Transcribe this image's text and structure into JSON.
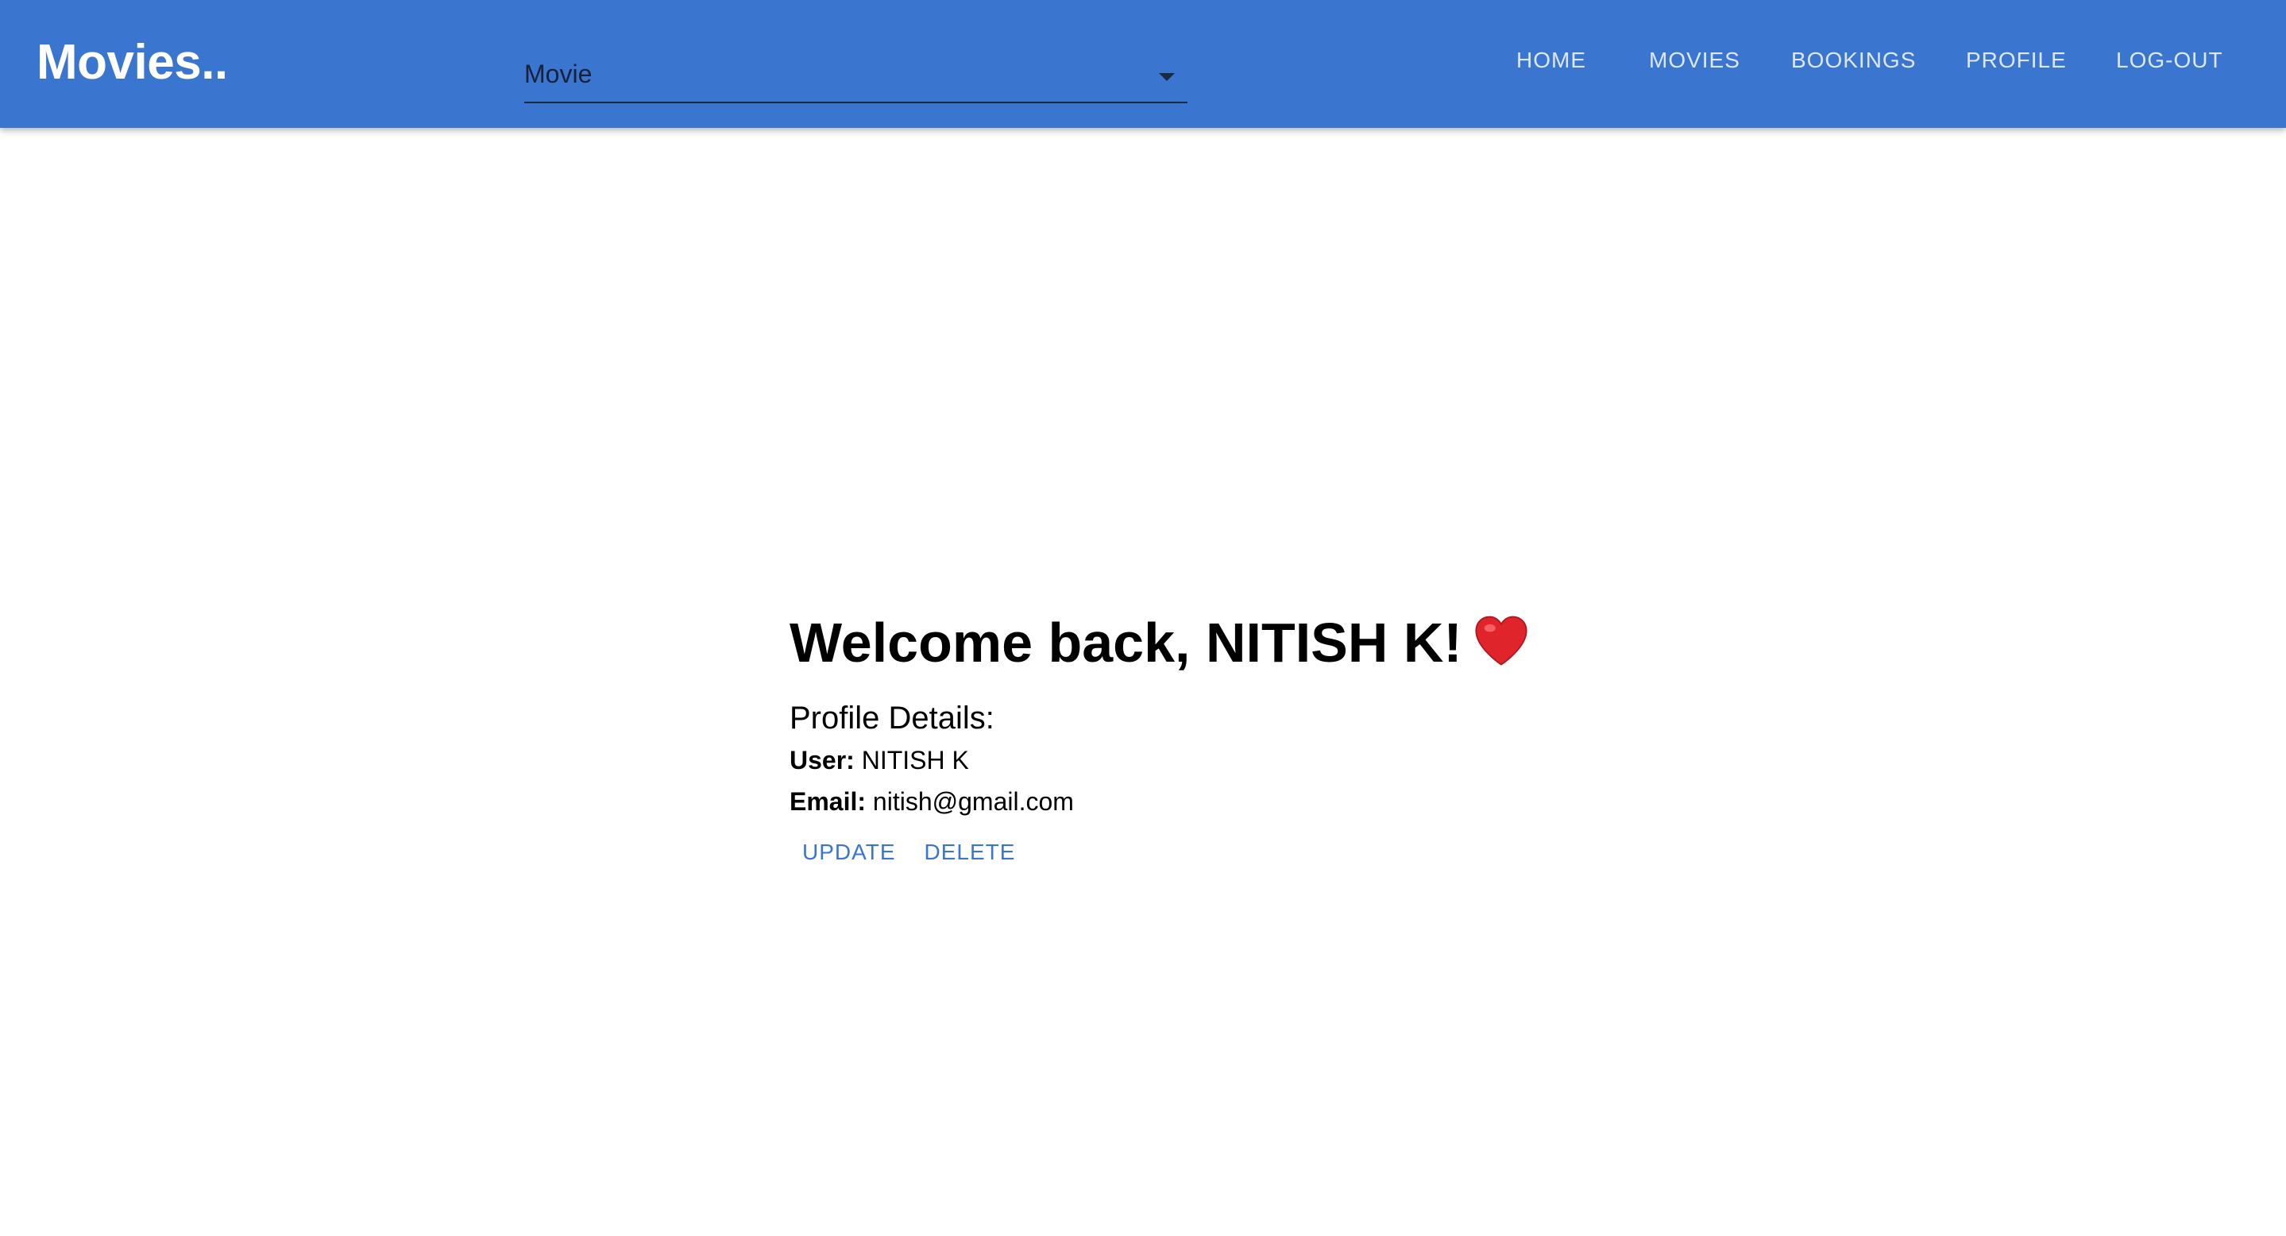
{
  "header": {
    "brand": "Movies..",
    "movie_select": {
      "value": "Movie"
    },
    "nav": {
      "home": "HOME",
      "movies": "MOVIES",
      "bookings": "BOOKINGS",
      "profile": "PROFILE",
      "logout": "LOG-OUT"
    }
  },
  "profile": {
    "welcome": "Welcome back, NITISH K!",
    "details_title": "Profile Details:",
    "user_label": "User:",
    "user_value": "NITISH K",
    "email_label": "Email:",
    "email_value": "nitish@gmail.com",
    "update_label": "UPDATE",
    "delete_label": "DELETE",
    "heart_icon": "heart-icon"
  },
  "colors": {
    "appbar": "#3a75cf",
    "nav_text": "#dce7f7",
    "button_text": "#3a75cf",
    "heart": "#e0242c"
  }
}
